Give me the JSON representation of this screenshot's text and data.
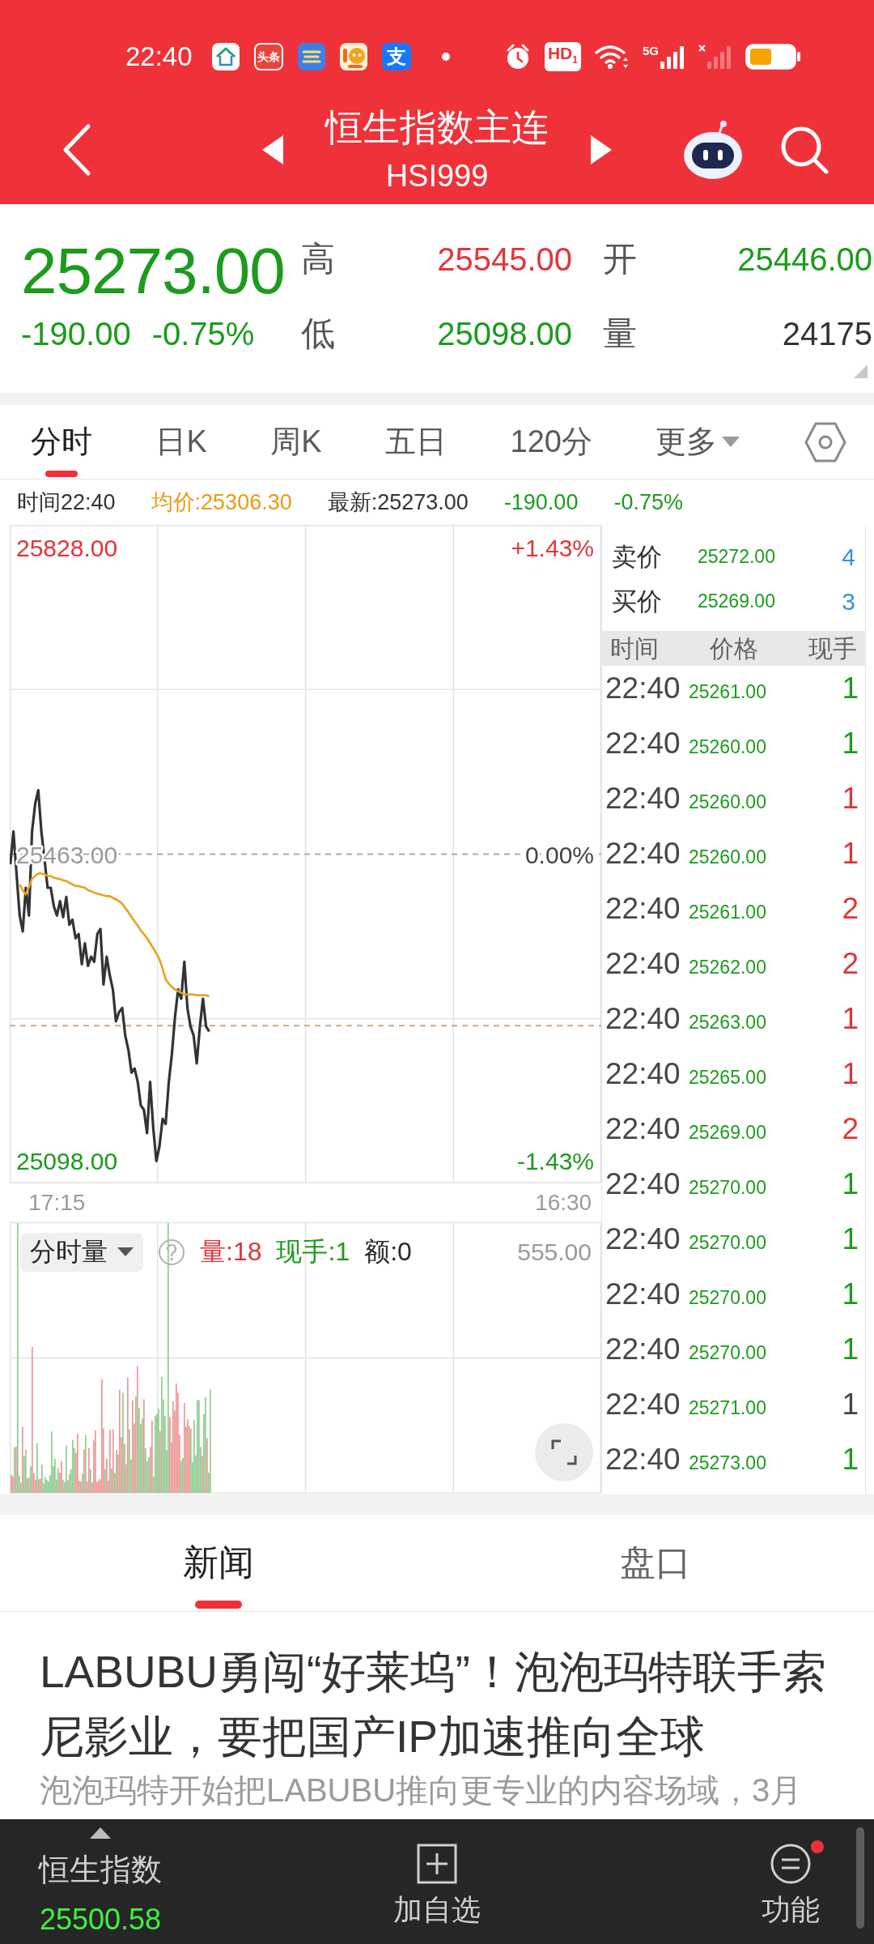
{
  "status_bar": {
    "time": "22:40",
    "app_tiles": [
      {
        "text": "头条",
        "color": "#e9443b"
      },
      {
        "text": "支",
        "color": "#1677ff"
      }
    ],
    "hd": "HD$_{1}$",
    "network": "5G"
  },
  "header": {
    "title": "恒生指数主连",
    "code": "HSI999"
  },
  "quote": {
    "price": "25273.00",
    "change": "-190.00",
    "change_pct": "-0.75%",
    "color": "#1c9b1c",
    "stats": [
      {
        "label": "高",
        "value": "25545.00",
        "color": "#e0363a"
      },
      {
        "label": "开",
        "value": "25446.00",
        "color": "#1c9b1c"
      },
      {
        "label": "低",
        "value": "25098.00",
        "color": "#1c9b1c"
      },
      {
        "label": "量",
        "value": "24175",
        "color": "#333333"
      }
    ]
  },
  "chart_tabs": [
    {
      "label": "分时",
      "selected": true,
      "kind": "tab"
    },
    {
      "label": "日K",
      "selected": false,
      "kind": "tab"
    },
    {
      "label": "周K",
      "selected": false,
      "kind": "tab"
    },
    {
      "label": "五日",
      "selected": false,
      "kind": "tab"
    },
    {
      "label": "120分",
      "selected": false,
      "kind": "tab"
    },
    {
      "label": "更多",
      "selected": false,
      "kind": "menu"
    }
  ],
  "info_line": [
    {
      "text": "时间22:40",
      "color": "#333333"
    },
    {
      "text": "均价:25306.30",
      "color": "#e89b12"
    },
    {
      "text": "最新:25273.00",
      "color": "#333333"
    },
    {
      "text": "-190.00",
      "color": "#1c9b1c"
    },
    {
      "text": "-0.75%",
      "color": "#1c9b1c"
    }
  ],
  "price_chart": {
    "percent_labels": [
      "+1.43%",
      "0.00%",
      "-1.43%"
    ],
    "chart_data": {
      "type": "line",
      "categories": [
        null,
        null,
        null,
        null,
        null,
        null,
        null,
        null,
        null,
        null,
        null,
        null,
        null,
        null,
        null,
        "17:15",
        null,
        null,
        null,
        null,
        null,
        null,
        null,
        null,
        null,
        null,
        null,
        null,
        null,
        null,
        null,
        null,
        null,
        null,
        null,
        null,
        null,
        null,
        null,
        null,
        null,
        null,
        null,
        null,
        null,
        null,
        null,
        null,
        null,
        null,
        null,
        null,
        null,
        null,
        null,
        null,
        null,
        null,
        null,
        null,
        null,
        null,
        null,
        null,
        null,
        null,
        null,
        null,
        null,
        null,
        null,
        null,
        null,
        null,
        null,
        null,
        null,
        null,
        null,
        null,
        null,
        null,
        null,
        null,
        null,
        null,
        null,
        null,
        null,
        null,
        null,
        null,
        null,
        null,
        null,
        null,
        null,
        null,
        null,
        null,
        null,
        null,
        null,
        null,
        null,
        null,
        null,
        null,
        null,
        null,
        null,
        null,
        null,
        null,
        null,
        null,
        null,
        null,
        null,
        null,
        null,
        null,
        null,
        null,
        null,
        null,
        null,
        null,
        null,
        null,
        null,
        null,
        null,
        null,
        null,
        null,
        null,
        null,
        null,
        null,
        null,
        null,
        null,
        null,
        null,
        null,
        null,
        null,
        null,
        null,
        null,
        null,
        null,
        null,
        null,
        null,
        null,
        null,
        null,
        null,
        null,
        null,
        null,
        null,
        null,
        null,
        null,
        null,
        null,
        null,
        null,
        null,
        null,
        null,
        null,
        null,
        null,
        null,
        "16:30",
        null,
        null,
        null,
        null,
        null,
        null,
        null,
        null,
        null,
        null,
        null,
        null
      ],
      "ylim": [
        25072,
        25854
      ],
      "yticks": [
        {
          "value": 25828,
          "label": "25828.00"
        },
        {
          "value": 25463,
          "label": "25463.00"
        },
        {
          "value": 25098,
          "label": "25098.00"
        }
      ],
      "series": [
        {
          "color": "#333333",
          "values": [
            25451,
            25490,
            25440,
            25390,
            25371,
            25423,
            25390,
            25490,
            25523,
            25539,
            25490,
            25457,
            25423,
            25423,
            25401,
            25390,
            25407,
            25388,
            25412,
            25379,
            25385,
            25363,
            25368,
            25332,
            25357,
            25330,
            25341,
            25335,
            25368,
            25374,
            25308,
            25341,
            25319,
            25302,
            25264,
            25275,
            25280,
            25247,
            25230,
            25203,
            25208,
            25192,
            25164,
            25159,
            25131,
            25192,
            25137,
            25098,
            25115,
            25148,
            25142,
            25192,
            25225,
            25269,
            25302,
            25291,
            25335,
            25280,
            25258,
            25247,
            25214,
            25258,
            25291,
            25258,
            25252,
            null,
            null,
            null,
            null,
            null,
            null,
            null,
            null,
            null,
            null,
            null,
            null,
            null,
            null,
            null,
            null,
            null,
            null,
            null,
            null,
            null,
            null,
            null,
            null,
            null,
            null,
            null,
            null,
            null,
            null,
            null,
            null,
            null,
            null,
            null,
            null,
            null,
            null,
            null,
            null,
            null,
            null,
            null,
            null,
            null,
            null,
            null,
            null,
            null,
            null,
            null,
            null,
            null,
            null,
            null,
            null,
            null,
            null,
            null,
            null,
            null,
            null,
            null,
            null,
            null,
            null,
            null,
            null,
            null,
            null,
            null,
            null,
            null,
            null,
            null,
            null,
            null,
            null,
            null,
            null,
            null,
            null,
            null,
            null,
            null,
            null,
            null,
            null,
            null,
            null,
            null,
            null,
            null,
            null,
            null,
            null,
            null,
            null,
            null,
            null,
            null,
            null,
            null,
            null,
            null,
            null,
            null,
            null,
            null,
            null,
            null,
            null,
            null,
            null,
            null,
            null,
            null,
            null,
            null,
            null,
            null,
            null,
            null,
            null,
            null,
            null
          ]
        },
        {
          "color": "#e6a21e",
          "values": [
            null,
            null,
            null,
            25427,
            25420,
            25415,
            25424,
            25434,
            25437,
            25440,
            25440,
            25439,
            25437,
            25437,
            25435,
            25434,
            25433,
            25432,
            25431,
            25429,
            25427,
            25425,
            25425,
            25424,
            25423,
            25420,
            25419,
            25417,
            25416,
            25415,
            25414,
            25413,
            25413,
            25411,
            25409,
            25407,
            25404,
            25399,
            25394,
            25388,
            25383,
            25378,
            25372,
            25368,
            25363,
            25357,
            25351,
            25345,
            25338,
            25327,
            25314,
            25309,
            25305,
            25302,
            25300,
            25298,
            25296,
            25296,
            25296,
            25296,
            25295,
            25295,
            25295,
            25295,
            25294,
            null,
            null,
            null,
            null,
            null,
            null,
            null,
            null,
            null,
            null,
            null,
            null,
            null,
            null,
            null,
            null,
            null,
            null,
            null,
            null,
            null,
            null,
            null,
            null,
            null,
            null,
            null,
            null,
            null,
            null,
            null,
            null,
            null,
            null,
            null,
            null,
            null,
            null,
            null,
            null,
            null,
            null,
            null,
            null,
            null,
            null,
            null,
            null,
            null,
            null,
            null,
            null,
            null,
            null,
            null,
            null,
            null,
            null,
            null,
            null,
            null,
            null,
            null,
            null,
            null,
            null,
            null,
            null,
            null,
            null,
            null,
            null,
            null,
            null,
            null,
            null,
            null,
            null,
            null,
            null,
            null,
            null,
            null,
            null,
            null,
            null,
            null,
            null,
            null,
            null,
            null,
            null,
            null,
            null,
            null,
            null,
            null,
            null,
            null,
            null,
            null,
            null,
            null,
            null,
            null,
            null,
            null,
            null,
            null,
            null,
            null,
            null,
            null,
            null,
            null,
            null,
            null,
            null,
            null,
            null,
            null,
            null,
            null,
            null,
            null,
            null
          ]
        }
      ],
      "ref_lines": [
        {
          "axis": "y",
          "value": 25463,
          "color": "#aaaaaa"
        },
        {
          "axis": "y",
          "value": 25259,
          "color": "#c9a98c"
        }
      ]
    }
  },
  "volume_chart": {
    "selector": "分时量",
    "volume": "量:18",
    "hand": "现手:1",
    "amount": "额:0",
    "max": "555.00"
  },
  "trade_panel": {
    "quotes": [
      {
        "label": "卖价",
        "price": "25272.00",
        "count": "4"
      },
      {
        "label": "买价",
        "price": "25269.00",
        "count": "3"
      }
    ],
    "columns": [
      "时间",
      "价格",
      "现手"
    ],
    "rows": [
      {
        "time": "22:40",
        "price": "25261.00",
        "qty": "1",
        "color": "#1c9b1c"
      },
      {
        "time": "22:40",
        "price": "25260.00",
        "qty": "1",
        "color": "#1c9b1c"
      },
      {
        "time": "22:40",
        "price": "25260.00",
        "qty": "1",
        "color": "#e0363a"
      },
      {
        "time": "22:40",
        "price": "25260.00",
        "qty": "1",
        "color": "#e0363a"
      },
      {
        "time": "22:40",
        "price": "25261.00",
        "qty": "2",
        "color": "#e0363a"
      },
      {
        "time": "22:40",
        "price": "25262.00",
        "qty": "2",
        "color": "#e0363a"
      },
      {
        "time": "22:40",
        "price": "25263.00",
        "qty": "1",
        "color": "#e0363a"
      },
      {
        "time": "22:40",
        "price": "25265.00",
        "qty": "1",
        "color": "#e0363a"
      },
      {
        "time": "22:40",
        "price": "25269.00",
        "qty": "2",
        "color": "#e0363a"
      },
      {
        "time": "22:40",
        "price": "25270.00",
        "qty": "1",
        "color": "#1c9b1c"
      },
      {
        "time": "22:40",
        "price": "25270.00",
        "qty": "1",
        "color": "#1c9b1c"
      },
      {
        "time": "22:40",
        "price": "25270.00",
        "qty": "1",
        "color": "#1c9b1c"
      },
      {
        "time": "22:40",
        "price": "25270.00",
        "qty": "1",
        "color": "#1c9b1c"
      },
      {
        "time": "22:40",
        "price": "25271.00",
        "qty": "1",
        "color": "#444444"
      },
      {
        "time": "22:40",
        "price": "25273.00",
        "qty": "1",
        "color": "#1c9b1c"
      }
    ]
  },
  "bottom_tabs": [
    {
      "label": "新闻",
      "selected": true
    },
    {
      "label": "盘口",
      "selected": false
    }
  ],
  "news": {
    "headline": "LABUBU勇闯“好莱坞”！泡泡玛特联手索尼影业，要把国产IP加速推向全球",
    "summary": "泡泡玛特开始把LABUBU推向更专业的内容场域，3月"
  },
  "bottom_bar": {
    "index_name": "恒生指数",
    "index_value": "25500.58",
    "actions": [
      {
        "label": "加自选",
        "kind": "add",
        "badge": false
      },
      {
        "label": "功能",
        "kind": "menu",
        "badge": true
      }
    ]
  }
}
